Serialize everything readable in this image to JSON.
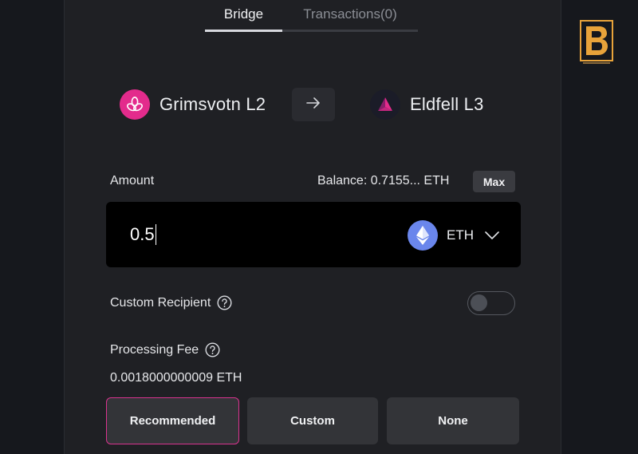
{
  "tabs": [
    {
      "label": "Bridge",
      "active": true
    },
    {
      "label": "Transactions(0)",
      "active": false
    }
  ],
  "networks": {
    "from": {
      "name": "Grimsvotn L2",
      "icon": "grimsvotn-logo-icon",
      "color": "#e32b8c"
    },
    "to": {
      "name": "Eldfell L3",
      "icon": "eldfell-logo-icon",
      "color": "#e32b8c"
    },
    "swap_icon": "arrow-right-icon"
  },
  "amount": {
    "label": "Amount",
    "balance": "Balance: 0.7155... ETH",
    "max_label": "Max",
    "value": "0.5",
    "token": "ETH",
    "token_icon": "ethereum-icon"
  },
  "recipient": {
    "label": "Custom Recipient",
    "enabled": false
  },
  "fee": {
    "label": "Processing Fee",
    "value": "0.0018000000009 ETH",
    "options": [
      {
        "label": "Recommended",
        "selected": true
      },
      {
        "label": "Custom",
        "selected": false
      },
      {
        "label": "None",
        "selected": false
      }
    ]
  },
  "colors": {
    "accent": "#d9338f",
    "background": "#16181d",
    "panel": "#1f2024",
    "input_bg": "#000000",
    "logo_gold": "#e8a33a"
  },
  "logo": {
    "letter": "B",
    "caption": "ExchangeDefiCenter.com"
  }
}
